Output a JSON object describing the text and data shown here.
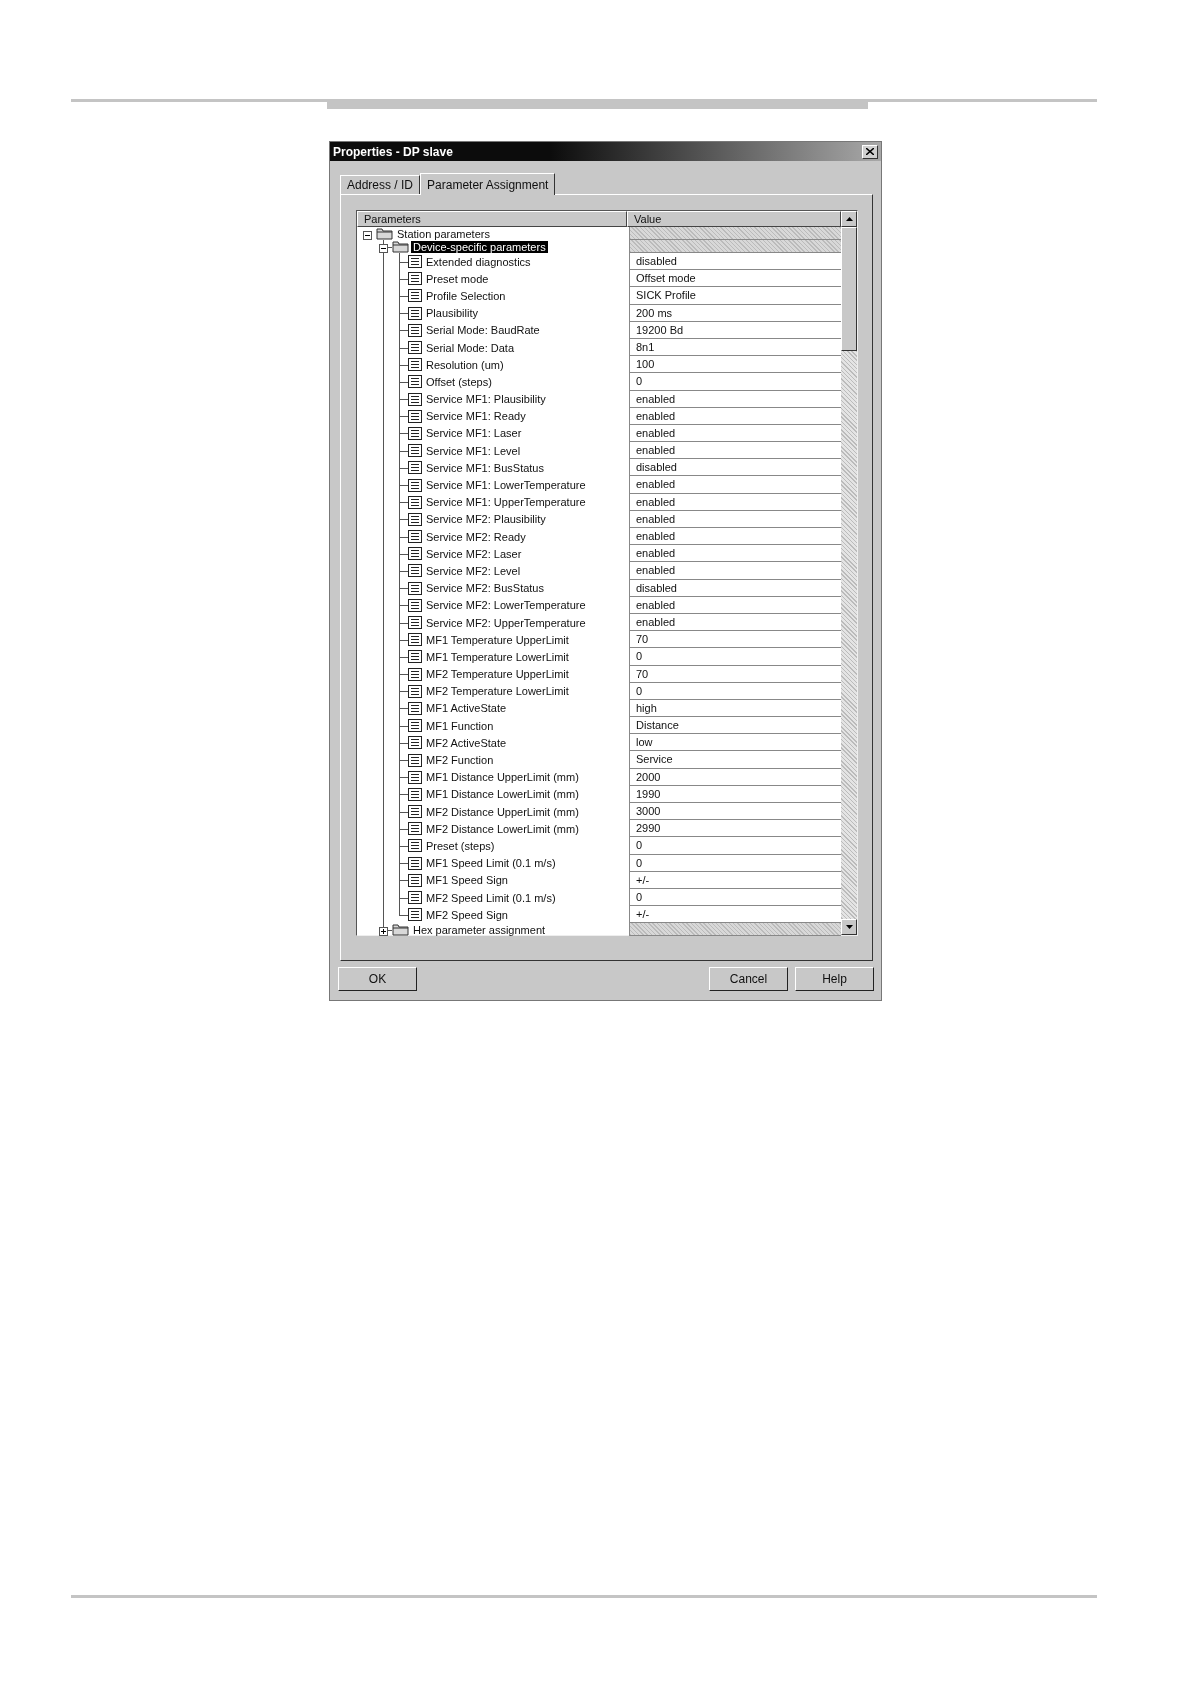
{
  "window": {
    "title": "Properties - DP slave"
  },
  "tabs": [
    {
      "label": "Address / ID",
      "selected": false
    },
    {
      "label": "Parameter Assignment",
      "selected": true
    }
  ],
  "table": {
    "columns": [
      "Parameters",
      "Value"
    ],
    "tree": [
      {
        "label": "Station parameters",
        "expanded": true,
        "selected": false,
        "children": [
          {
            "label": "Device-specific parameters",
            "expanded": true,
            "selected": true,
            "children": [
              {
                "label": "Extended diagnostics",
                "value": "disabled",
                "selected": false
              },
              {
                "label": "Preset mode",
                "value": "Offset mode",
                "selected": false
              },
              {
                "label": "Profile Selection",
                "value": "SICK Profile",
                "selected": false
              },
              {
                "label": "Plausibility",
                "value": "200 ms",
                "selected": false
              },
              {
                "label": "Serial Mode: BaudRate",
                "value": "19200 Bd",
                "selected": false
              },
              {
                "label": "Serial Mode: Data",
                "value": "8n1",
                "selected": false
              },
              {
                "label": "Resolution (um)",
                "value": "100",
                "selected": false
              },
              {
                "label": "Offset (steps)",
                "value": "0",
                "selected": false
              },
              {
                "label": "Service MF1: Plausibility",
                "value": "enabled",
                "selected": false
              },
              {
                "label": "Service MF1: Ready",
                "value": "enabled",
                "selected": false
              },
              {
                "label": "Service MF1: Laser",
                "value": "enabled",
                "selected": false
              },
              {
                "label": "Service MF1: Level",
                "value": "enabled",
                "selected": false
              },
              {
                "label": "Service MF1: BusStatus",
                "value": "disabled",
                "selected": false
              },
              {
                "label": "Service MF1: LowerTemperature",
                "value": "enabled",
                "selected": false
              },
              {
                "label": "Service MF1: UpperTemperature",
                "value": "enabled",
                "selected": false
              },
              {
                "label": "Service MF2: Plausibility",
                "value": "enabled",
                "selected": false
              },
              {
                "label": "Service MF2: Ready",
                "value": "enabled",
                "selected": false
              },
              {
                "label": "Service MF2: Laser",
                "value": "enabled",
                "selected": false
              },
              {
                "label": "Service MF2: Level",
                "value": "enabled",
                "selected": false
              },
              {
                "label": "Service MF2: BusStatus",
                "value": "disabled",
                "selected": false
              },
              {
                "label": "Service MF2: LowerTemperature",
                "value": "enabled",
                "selected": false
              },
              {
                "label": "Service MF2: UpperTemperature",
                "value": "enabled",
                "selected": false
              },
              {
                "label": "MF1 Temperature UpperLimit",
                "value": "70",
                "selected": false
              },
              {
                "label": "MF1 Temperature LowerLimit",
                "value": "0",
                "selected": false
              },
              {
                "label": "MF2 Temperature UpperLimit",
                "value": "70",
                "selected": false
              },
              {
                "label": "MF2 Temperature LowerLimit",
                "value": "0",
                "selected": false
              },
              {
                "label": "MF1 ActiveState",
                "value": "high",
                "selected": false
              },
              {
                "label": "MF1 Function",
                "value": "Distance",
                "selected": false
              },
              {
                "label": "MF2 ActiveState",
                "value": "low",
                "selected": false
              },
              {
                "label": "MF2 Function",
                "value": "Service",
                "selected": false
              },
              {
                "label": "MF1 Distance UpperLimit (mm)",
                "value": "2000",
                "selected": false
              },
              {
                "label": "MF1 Distance LowerLimit (mm)",
                "value": "1990",
                "selected": false
              },
              {
                "label": "MF2 Distance UpperLimit (mm)",
                "value": "3000",
                "selected": false
              },
              {
                "label": "MF2 Distance LowerLimit (mm)",
                "value": "2990",
                "selected": false
              },
              {
                "label": "Preset (steps)",
                "value": "0",
                "selected": false
              },
              {
                "label": "MF1 Speed Limit (0.1 m/s)",
                "value": "0",
                "selected": false
              },
              {
                "label": "MF1 Speed Sign",
                "value": "+/-",
                "selected": false
              },
              {
                "label": "MF2 Speed Limit (0.1 m/s)",
                "value": "0",
                "selected": false
              },
              {
                "label": "MF2 Speed Sign",
                "value": "+/-",
                "selected": false
              }
            ]
          },
          {
            "label": "Hex parameter assignment",
            "expanded": false,
            "selected": false
          }
        ]
      }
    ]
  },
  "buttons": [
    "OK",
    "Cancel",
    "Help"
  ]
}
